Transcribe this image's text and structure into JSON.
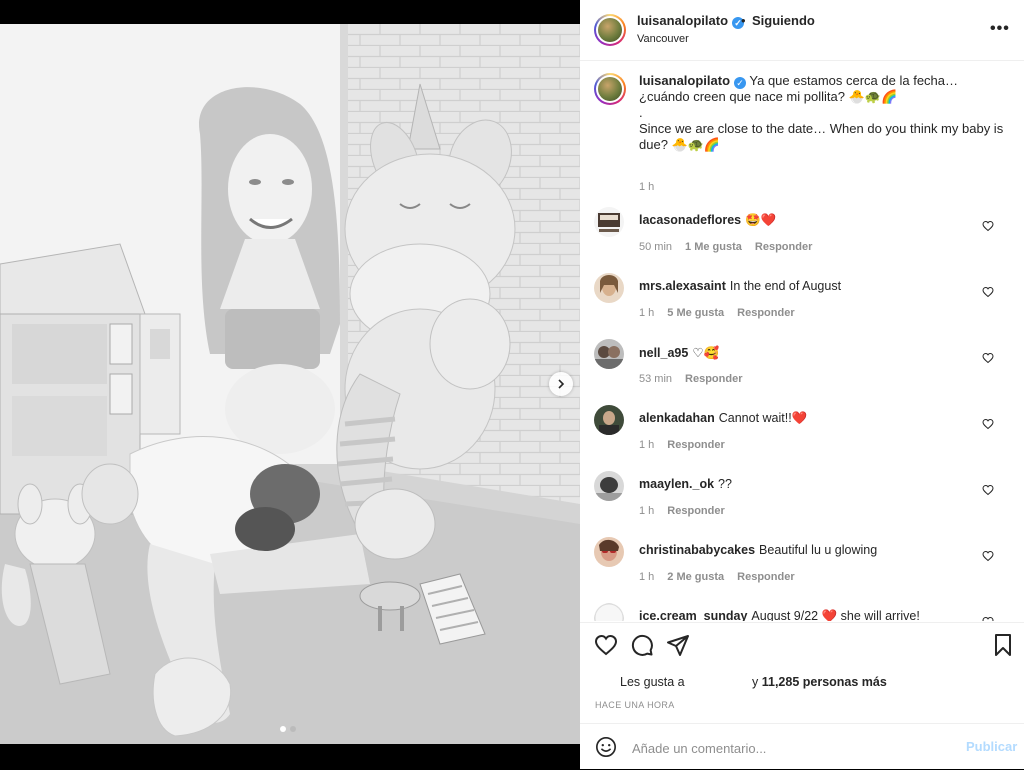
{
  "header": {
    "username": "luisanalopilato",
    "verified_mark": "✓",
    "dot": "•",
    "follow_status": "Siguiendo",
    "location": "Vancouver",
    "more": "•••"
  },
  "caption": {
    "username": "luisanalopilato",
    "line1": "Ya que estamos cerca de la fecha… ¿cuándo creen que nace mi pollita? 🐣🐢🌈",
    "line2": ".",
    "line3": "Since we are close to the date… When do you think my baby is due? 🐣🐢🌈",
    "time": "1 h"
  },
  "comments": [
    {
      "user": "lacasonadeflores",
      "text": "🤩❤️",
      "time": "50 min",
      "likes": "1 Me gusta",
      "reply": "Responder"
    },
    {
      "user": "mrs.alexasaint",
      "text": "In the end of August",
      "time": "1 h",
      "likes": "5 Me gusta",
      "reply": "Responder"
    },
    {
      "user": "nell_a95",
      "text": "♡🥰",
      "time": "53 min",
      "likes": "",
      "reply": "Responder"
    },
    {
      "user": "alenkadahan",
      "text": "Cannot wait!!❤️",
      "time": "1 h",
      "likes": "",
      "reply": "Responder"
    },
    {
      "user": "maaylen._ok",
      "text": "??",
      "time": "1 h",
      "likes": "",
      "reply": "Responder"
    },
    {
      "user": "christinababycakes",
      "text": "Beautiful lu u glowing",
      "time": "1 h",
      "likes": "2 Me gusta",
      "reply": "Responder"
    },
    {
      "user": "ice.cream_sunday",
      "text": "August 9/22 ❤️ she will arrive!",
      "time": "",
      "likes": "",
      "reply": ""
    }
  ],
  "actions": {
    "likes_prefix": "Les gusta a",
    "likes_suffix_pre": "y",
    "likes_count": "11,285 personas más",
    "timestamp": "HACE UNA HORA"
  },
  "add_comment": {
    "placeholder": "Añade un comentario...",
    "post": "Publicar"
  },
  "colors": {
    "verified": "#3897f0",
    "like_red": "#ed4956",
    "post_disabled": "#b3dbff",
    "meta_gray": "#8e8e8e"
  }
}
